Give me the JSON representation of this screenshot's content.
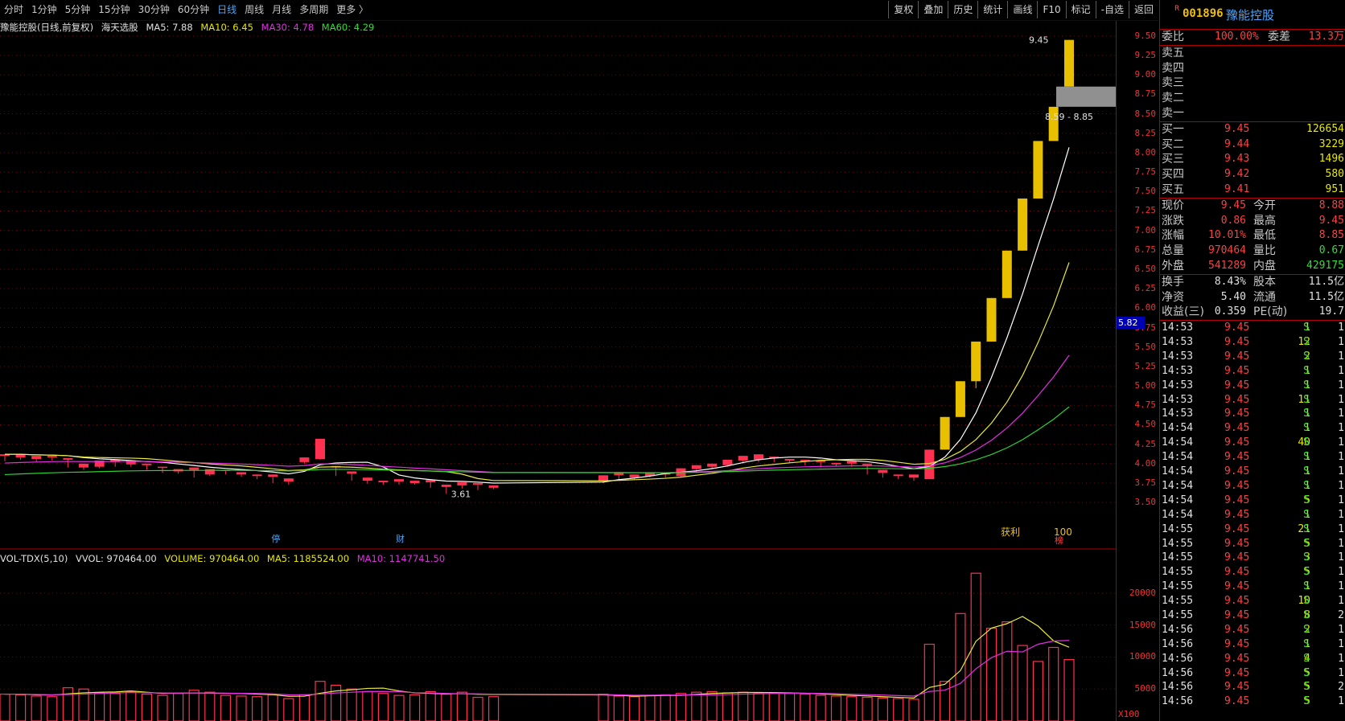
{
  "toolbar": {
    "periods": [
      "分时",
      "1分钟",
      "5分钟",
      "15分钟",
      "30分钟",
      "60分钟",
      "日线",
      "周线",
      "月线",
      "多周期",
      "更多 〉"
    ],
    "active_period": "日线",
    "buttons": [
      "复权",
      "叠加",
      "历史",
      "统计",
      "画线",
      "F10",
      "标记",
      "-自选",
      "返回"
    ]
  },
  "legend": {
    "title": "豫能控股(日线,前复权)",
    "tool": "海天选股",
    "ma5": "MA5: 7.88",
    "ma10": "MA10: 6.45",
    "ma30": "MA30: 4.78",
    "ma60": "MA60: 4.29"
  },
  "annotations": {
    "high_label": "9.45",
    "range_label": "8.59 - 8.85",
    "low_label": "3.61",
    "profit_label": "获利",
    "profit_value": "100",
    "marker_left": "停",
    "marker_mid": "财",
    "marker_right": "榜"
  },
  "vol_legend": {
    "name": "VOL-TDX(5,10)",
    "vvol": "VVOL: 970464.00",
    "volume": "VOLUME: 970464.00",
    "ma5": "MA5: 1185524.00",
    "ma10": "MA10: 1147741.50",
    "unit": "X100"
  },
  "axis": {
    "price_ticks": [
      "9.50",
      "9.25",
      "9.00",
      "8.75",
      "8.50",
      "8.25",
      "8.00",
      "7.75",
      "7.50",
      "7.25",
      "7.00",
      "6.75",
      "6.50",
      "6.25",
      "6.00",
      "5.75",
      "5.50",
      "5.25",
      "5.00",
      "4.75",
      "4.50",
      "4.25",
      "4.00",
      "3.75",
      "3.50"
    ],
    "vol_ticks": [
      "20000",
      "15000",
      "10000",
      "5000"
    ],
    "current_price_tag": "5.82"
  },
  "colors": {
    "up": "#ff3050",
    "down": "#3ad0ff",
    "limit_up": "#e8c000",
    "ma5": "#ffffff",
    "ma10": "#e8e840",
    "ma30": "#e030e0",
    "ma60": "#30d030",
    "grid": "#7a0000"
  },
  "chart_data": {
    "type": "candlestick",
    "series": [
      {
        "name": "K",
        "values": [
          [
            4.1,
            4.12,
            4.03,
            4.1
          ],
          [
            4.08,
            4.12,
            4.05,
            4.06
          ],
          [
            4.06,
            4.1,
            4.02,
            4.08
          ],
          [
            4.08,
            4.1,
            4.04,
            4.05
          ],
          [
            4.05,
            4.07,
            3.95,
            3.97
          ],
          [
            3.95,
            4.0,
            3.92,
            3.96
          ],
          [
            3.96,
            4.04,
            3.94,
            4.03
          ],
          [
            4.02,
            4.05,
            3.96,
            3.98
          ],
          [
            3.99,
            4.04,
            3.96,
            3.98
          ],
          [
            3.98,
            4.0,
            3.92,
            3.95
          ],
          [
            3.95,
            3.96,
            3.88,
            3.9
          ],
          [
            3.9,
            3.93,
            3.87,
            3.88
          ],
          [
            3.92,
            3.95,
            3.82,
            3.84
          ],
          [
            3.86,
            3.93,
            3.84,
            3.91
          ],
          [
            3.91,
            3.92,
            3.86,
            3.87
          ],
          [
            3.86,
            3.89,
            3.83,
            3.85
          ],
          [
            3.84,
            3.86,
            3.8,
            3.83
          ],
          [
            3.83,
            3.86,
            3.75,
            3.77
          ],
          [
            3.77,
            3.81,
            3.73,
            3.75
          ],
          [
            4.02,
            4.08,
            4.0,
            4.07
          ],
          [
            4.06,
            4.32,
            4.05,
            4.32
          ],
          [
            3.95,
            3.97,
            3.84,
            3.86
          ],
          [
            3.87,
            3.9,
            3.78,
            3.8
          ],
          [
            3.78,
            3.82,
            3.74,
            3.76
          ],
          [
            3.76,
            3.78,
            3.73,
            3.77
          ],
          [
            3.77,
            3.8,
            3.73,
            3.75
          ],
          [
            3.75,
            3.78,
            3.73,
            3.76
          ],
          [
            3.76,
            3.79,
            3.69,
            3.71
          ],
          [
            3.7,
            3.73,
            3.61,
            3.68
          ],
          [
            3.72,
            3.76,
            3.68,
            3.7
          ],
          [
            3.73,
            3.75,
            3.66,
            3.67
          ],
          [
            3.69,
            3.72,
            3.67,
            3.7
          ],
          [
            3.78,
            3.85,
            3.75,
            3.82
          ],
          [
            3.85,
            3.89,
            3.8,
            3.82
          ],
          [
            3.82,
            3.86,
            3.8,
            3.84
          ],
          [
            3.84,
            3.88,
            3.82,
            3.86
          ],
          [
            3.86,
            3.88,
            3.82,
            3.84
          ],
          [
            3.84,
            3.94,
            3.82,
            3.94
          ],
          [
            3.93,
            3.98,
            3.88,
            3.96
          ],
          [
            3.96,
            4.0,
            3.94,
            3.99
          ],
          [
            3.98,
            4.05,
            3.96,
            4.05
          ],
          [
            4.04,
            4.1,
            4.0,
            4.04
          ],
          [
            4.05,
            4.12,
            4.02,
            4.07
          ],
          [
            4.07,
            4.09,
            4.02,
            4.04
          ],
          [
            4.04,
            4.06,
            4.01,
            4.03
          ],
          [
            4.03,
            4.05,
            3.98,
            4.0
          ],
          [
            4.02,
            4.04,
            3.95,
            3.97
          ],
          [
            3.99,
            4.01,
            3.96,
            4.0
          ],
          [
            4.0,
            4.03,
            3.96,
            3.99
          ],
          [
            3.98,
            4.0,
            3.86,
            3.88
          ],
          [
            3.88,
            3.92,
            3.82,
            3.84
          ],
          [
            3.84,
            3.86,
            3.8,
            3.82
          ],
          [
            3.82,
            3.86,
            3.78,
            3.79
          ],
          [
            3.8,
            4.18,
            3.8,
            4.18
          ],
          [
            4.18,
            4.6,
            4.27,
            4.6
          ],
          [
            4.6,
            5.06,
            4.88,
            5.06
          ],
          [
            5.06,
            5.57,
            4.97,
            5.57
          ],
          [
            5.57,
            6.13,
            5.72,
            6.13
          ],
          [
            6.13,
            6.74,
            6.25,
            6.74
          ],
          [
            6.74,
            7.41,
            6.96,
            7.41
          ],
          [
            7.41,
            8.15,
            7.79,
            8.15
          ],
          [
            8.15,
            8.59,
            8.4,
            8.59
          ],
          [
            8.85,
            9.45,
            8.85,
            9.45
          ]
        ]
      }
    ],
    "volume": [
      {
        "name": "VOL",
        "values": [
          4200,
          4100,
          3900,
          3800,
          5200,
          5000,
          4400,
          4300,
          4600,
          4200,
          4000,
          4300,
          4800,
          4500,
          4000,
          3900,
          3800,
          4100,
          3500,
          4100,
          6200,
          5600,
          5000,
          4600,
          4300,
          4000,
          4100,
          4600,
          4200,
          4500,
          3700,
          3800,
          4200,
          3900,
          3800,
          4000,
          4100,
          4300,
          4500,
          4600,
          4400,
          4500,
          4300,
          4400,
          4300,
          4200,
          4000,
          3900,
          3800,
          3700,
          3600,
          3500,
          3400,
          12000,
          6200,
          16800,
          23100,
          14500,
          15500,
          11800,
          9300,
          11500,
          9600
        ]
      },
      {
        "name": "MA5",
        "values": [
          4200,
          4200,
          4100,
          4050,
          4240,
          4400,
          4500,
          4540,
          4700,
          4500,
          4300,
          4360,
          4380,
          4360,
          4320,
          4300,
          4200,
          4120,
          3860,
          3880,
          4340,
          4700,
          4880,
          5100,
          5140,
          4700,
          4400,
          4320,
          4240,
          4280,
          4180,
          4160,
          4080,
          4020,
          3880,
          3940,
          4000,
          4020,
          4160,
          4300,
          4380,
          4460,
          4460,
          4440,
          4380,
          4340,
          4240,
          4120,
          4000,
          3920,
          3800,
          3700,
          3600,
          5240,
          5740,
          7880,
          12460,
          14520,
          15220,
          16340,
          14840,
          12520,
          11540
        ]
      },
      {
        "name": "MA10",
        "values": [
          4200,
          4200,
          4150,
          4100,
          4150,
          4200,
          4300,
          4400,
          4450,
          4420,
          4380,
          4360,
          4400,
          4380,
          4360,
          4330,
          4300,
          4240,
          4100,
          4090,
          4220,
          4380,
          4500,
          4600,
          4620,
          4580,
          4420,
          4380,
          4300,
          4260,
          4240,
          4200,
          4150,
          4080,
          4020,
          4040,
          4060,
          4060,
          4080,
          4080,
          4140,
          4200,
          4250,
          4300,
          4320,
          4340,
          4310,
          4260,
          4180,
          4120,
          4060,
          3970,
          3900,
          4620,
          4810,
          5880,
          8160,
          9900,
          10900,
          10800,
          12000,
          12500,
          12600
        ]
      }
    ],
    "ma_lines": {
      "ma5": 7.88,
      "ma10": 6.45,
      "ma30": 4.78,
      "ma60": 4.29
    },
    "ylim": [
      3.45,
      9.55
    ],
    "vol_ylim": [
      0,
      24000
    ]
  },
  "quote": {
    "badge": "R",
    "code": "001896",
    "name": "豫能控股",
    "weibi_label": "委比",
    "weibi_value": "100.00%",
    "weicha_label": "委差",
    "weicha_value": "13.3万",
    "sell": [
      {
        "label": "卖五",
        "price": "",
        "vol": ""
      },
      {
        "label": "卖四",
        "price": "",
        "vol": ""
      },
      {
        "label": "卖三",
        "price": "",
        "vol": ""
      },
      {
        "label": "卖二",
        "price": "",
        "vol": ""
      },
      {
        "label": "卖一",
        "price": "",
        "vol": ""
      }
    ],
    "buy": [
      {
        "label": "买一",
        "price": "9.45",
        "vol": "126654"
      },
      {
        "label": "买二",
        "price": "9.44",
        "vol": "3229"
      },
      {
        "label": "买三",
        "price": "9.43",
        "vol": "1496"
      },
      {
        "label": "买四",
        "price": "9.42",
        "vol": "580"
      },
      {
        "label": "买五",
        "price": "9.41",
        "vol": "951"
      }
    ],
    "stats1": [
      {
        "l1": "现价",
        "v1": "9.45",
        "l2": "今开",
        "v2": "8.88"
      },
      {
        "l1": "涨跌",
        "v1": "0.86",
        "l2": "最高",
        "v2": "9.45"
      },
      {
        "l1": "涨幅",
        "v1": "10.01%",
        "l2": "最低",
        "v2": "8.85"
      },
      {
        "l1": "总量",
        "v1": "970464",
        "l2": "量比",
        "v2": "0.67"
      },
      {
        "l1": "外盘",
        "v1": "541289",
        "l2": "内盘",
        "v2": "429175"
      }
    ],
    "stats2": [
      {
        "l1": "换手",
        "v1": "8.43%",
        "l2": "股本",
        "v2": "11.5亿"
      },
      {
        "l1": "净资",
        "v1": "5.40",
        "l2": "流通",
        "v2": "11.5亿"
      },
      {
        "l1": "收益(三)",
        "v1": "0.359",
        "l2": "PE(动)",
        "v2": "19.7"
      }
    ],
    "ticks": [
      {
        "t": "14:53",
        "p": "9.45",
        "v": "1",
        "s": "S",
        "n": "1"
      },
      {
        "t": "14:53",
        "p": "9.45",
        "v": "12",
        "s": "S",
        "n": "1"
      },
      {
        "t": "14:53",
        "p": "9.45",
        "v": "2",
        "s": "S",
        "n": "1"
      },
      {
        "t": "14:53",
        "p": "9.45",
        "v": "1",
        "s": "S",
        "n": "1"
      },
      {
        "t": "14:53",
        "p": "9.45",
        "v": "1",
        "s": "S",
        "n": "1"
      },
      {
        "t": "14:53",
        "p": "9.45",
        "v": "11",
        "s": "S",
        "n": "1"
      },
      {
        "t": "14:53",
        "p": "9.45",
        "v": "1",
        "s": "S",
        "n": "1"
      },
      {
        "t": "14:54",
        "p": "9.45",
        "v": "1",
        "s": "S",
        "n": "1"
      },
      {
        "t": "14:54",
        "p": "9.45",
        "v": "40",
        "s": "S",
        "n": "1"
      },
      {
        "t": "14:54",
        "p": "9.45",
        "v": "1",
        "s": "S",
        "n": "1"
      },
      {
        "t": "14:54",
        "p": "9.45",
        "v": "1",
        "s": "S",
        "n": "1"
      },
      {
        "t": "14:54",
        "p": "9.45",
        "v": "1",
        "s": "S",
        "n": "1"
      },
      {
        "t": "14:54",
        "p": "9.45",
        "v": "5",
        "s": "S",
        "n": "1"
      },
      {
        "t": "14:54",
        "p": "9.45",
        "v": "1",
        "s": "S",
        "n": "1"
      },
      {
        "t": "14:55",
        "p": "9.45",
        "v": "21",
        "s": "S",
        "n": "1"
      },
      {
        "t": "14:55",
        "p": "9.45",
        "v": "5",
        "s": "S",
        "n": "1"
      },
      {
        "t": "14:55",
        "p": "9.45",
        "v": "3",
        "s": "S",
        "n": "1"
      },
      {
        "t": "14:55",
        "p": "9.45",
        "v": "5",
        "s": "S",
        "n": "1"
      },
      {
        "t": "14:55",
        "p": "9.45",
        "v": "1",
        "s": "S",
        "n": "1"
      },
      {
        "t": "14:55",
        "p": "9.45",
        "v": "10",
        "s": "S",
        "n": "1"
      },
      {
        "t": "14:55",
        "p": "9.45",
        "v": "8",
        "s": "S",
        "n": "2"
      },
      {
        "t": "14:56",
        "p": "9.45",
        "v": "2",
        "s": "S",
        "n": "1"
      },
      {
        "t": "14:56",
        "p": "9.45",
        "v": "1",
        "s": "S",
        "n": "1"
      },
      {
        "t": "14:56",
        "p": "9.45",
        "v": "4",
        "s": "S",
        "n": "1"
      },
      {
        "t": "14:56",
        "p": "9.45",
        "v": "5",
        "s": "S",
        "n": "1"
      },
      {
        "t": "14:56",
        "p": "9.45",
        "v": "5",
        "s": "S",
        "n": "2"
      },
      {
        "t": "14:56",
        "p": "9.45",
        "v": "5",
        "s": "S",
        "n": "1"
      }
    ]
  }
}
